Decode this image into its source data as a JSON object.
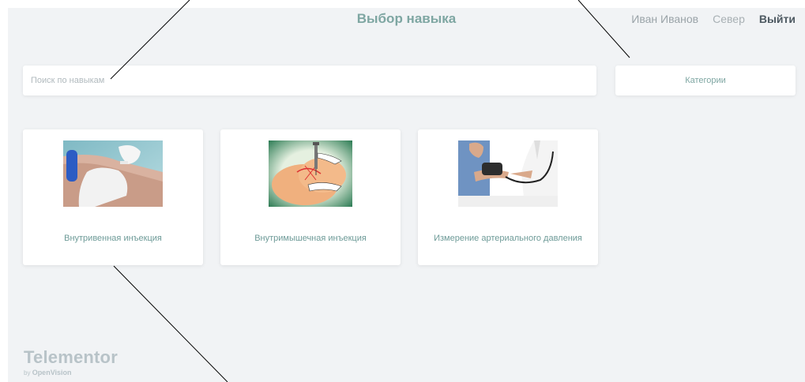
{
  "header": {
    "title": "Выбор навыка",
    "user_name": "Иван Иванов",
    "region": "Север",
    "logout_label": "Выйти"
  },
  "search": {
    "placeholder": "Поиск по навыкам",
    "value": ""
  },
  "categories": {
    "label": "Категории"
  },
  "skills": [
    {
      "label": "Внутривенная инъекция"
    },
    {
      "label": "Внутримышечная инъекция"
    },
    {
      "label": "Измерение артериального давления"
    }
  ],
  "footer": {
    "brand": "Telementor",
    "by_prefix": "by",
    "by_company": "OpenVision"
  },
  "colors": {
    "accent": "#7ea6a2",
    "background": "#f1f3f5",
    "card": "#ffffff"
  }
}
